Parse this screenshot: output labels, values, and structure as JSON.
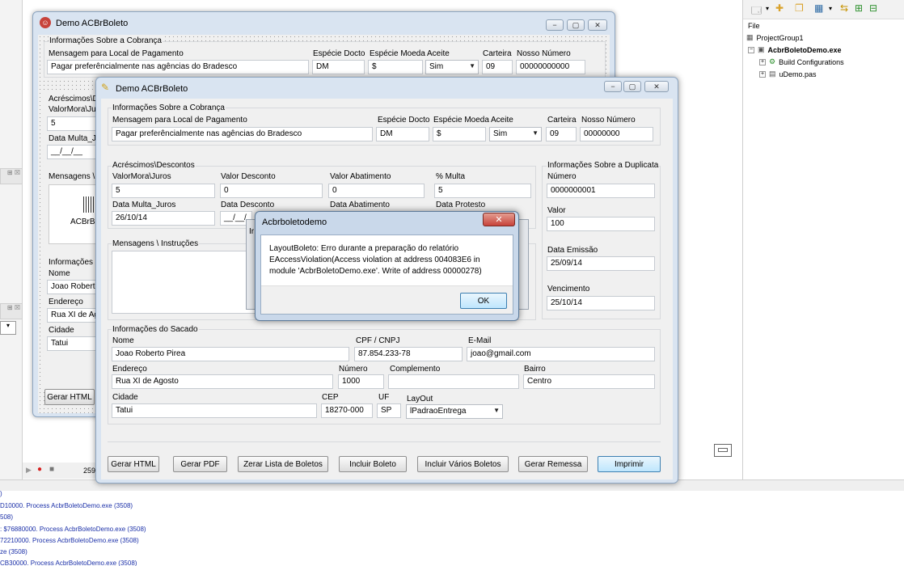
{
  "ide": {
    "status_number": "259",
    "log_lines": [
      ")",
      "D10000. Process AcbrBoletoDemo.exe (3508)",
      "508)",
      ": $76880000. Process AcbrBoletoDemo.exe (3508)",
      "72210000. Process AcbrBoletoDemo.exe (3508)",
      "ze (3508)",
      "CB30000. Process AcbrBoletoDemo.exe (3508)"
    ],
    "panel_label": "File",
    "tree": {
      "group": "ProjectGroup1",
      "project": "AcbrBoletoDemo.exe",
      "build": "Build Configurations",
      "unit": "uDemo.pas"
    }
  },
  "back_window": {
    "title": "Demo ACBrBoleto",
    "cobranca_group": "Informações Sobre a Cobrança",
    "mensagem_label": "Mensagem para Local de Pagamento",
    "mensagem_value": "Pagar preferêncialmente nas agências do Bradesco",
    "especie_docto_label": "Espécie Docto",
    "especie_docto_value": "DM",
    "especie_moeda_label": "Espécie Moeda",
    "especie_moeda_value": "$",
    "aceite_label": "Aceite",
    "aceite_value": "Sim",
    "carteira_label": "Carteira",
    "carteira_value": "09",
    "nosso_numero_label": "Nosso Número",
    "nosso_numero_value": "00000000000",
    "acrescimos_label": "Acréscimos\\D",
    "valor_mora_label": "ValorMora\\Jur",
    "valor_mora_value": "5",
    "data_multa_label": "Data Multa_Ju",
    "data_multa_value": "__/__/__",
    "mensagens_label": "Mensagens \\",
    "logo_text": "ACBrBo",
    "informacoes_label": "Informações d",
    "nome_label": "Nome",
    "nome_value": "Joao Roberto",
    "endereco_label": "Endereço",
    "endereco_value": "Rua XI de Ago",
    "cidade_label": "Cidade",
    "cidade_value": "Tatui",
    "gerar_html": "Gerar HTML"
  },
  "front_window": {
    "title": "Demo ACBrBoleto",
    "cobranca_group": "Informações Sobre a Cobrança",
    "mensagem_label": "Mensagem para Local de Pagamento",
    "mensagem_value": "Pagar preferêncialmente nas agências do Bradesco",
    "especie_docto_label": "Espécie Docto",
    "especie_docto_value": "DM",
    "especie_moeda_label": "Espécie Moeda",
    "especie_moeda_value": "$",
    "aceite_label": "Aceite",
    "aceite_value": "Sim",
    "carteira_label": "Carteira",
    "carteira_value": "09",
    "nosso_numero_label": "Nosso Número",
    "nosso_numero_value": "00000000",
    "acrescimos_group": "Acréscimos\\Descontos",
    "valor_mora_label": "ValorMora\\Juros",
    "valor_mora_value": "5",
    "valor_desconto_label": "Valor Desconto",
    "valor_desconto_value": "0",
    "valor_abatimento_label": "Valor Abatimento",
    "valor_abatimento_value": "0",
    "multa_label": "% Multa",
    "multa_value": "5",
    "data_multa_label": "Data Multa_Juros",
    "data_multa_value": "26/10/14",
    "data_desconto_label": "Data Desconto",
    "data_desconto_value": "__/__/__",
    "data_abatimento_label": "Data Abatimento",
    "data_protesto_label": "Data Protesto",
    "mensagens_group": "Mensagens \\ Instruções",
    "duplicata_group": "Informações Sobre a Duplicata",
    "numero_label": "Número",
    "numero_value": "0000000001",
    "valor_label": "Valor",
    "valor_value": "100",
    "data_emissao_label": "Data Emissão",
    "data_emissao_value": "25/09/14",
    "vencimento_label": "Vencimento",
    "vencimento_value": "25/10/14",
    "sacado_group": "Informações do Sacado",
    "nome_label": "Nome",
    "nome_value": "Joao Roberto Pirea",
    "cpf_label": "CPF / CNPJ",
    "cpf_value": "87.854.233-78",
    "email_label": "E-Mail",
    "email_value": "joao@gmail.com",
    "endereco_label": "Endereço",
    "endereco_value": "Rua XI de Agosto",
    "numero_end_label": "Número",
    "numero_end_value": "1000",
    "complemento_label": "Complemento",
    "complemento_value": "",
    "bairro_label": "Bairro",
    "bairro_value": "Centro",
    "cidade_label": "Cidade",
    "cidade_value": "Tatui",
    "cep_label": "CEP",
    "cep_value": "18270-000",
    "uf_label": "UF",
    "uf_value": "SP",
    "layout_label": "LayOut",
    "layout_value": "lPadraoEntrega",
    "buttons": {
      "gerar_html": "Gerar HTML",
      "gerar_pdf": "Gerar PDF",
      "zerar": "Zerar Lista de Boletos",
      "incluir": "Incluir Boleto",
      "incluir_varios": "Incluir Vários Boletos",
      "gerar_remessa": "Gerar Remessa",
      "imprimir": "Imprimir"
    }
  },
  "dialog": {
    "title": "Acbrboletodemo",
    "line1": "LayoutBoleto: Erro durante a preparação do relatório",
    "line2": "EAccessViolation(Access violation at address 004083E6 in",
    "line3": "module 'AcbrBoletoDemo.exe'. Write of address 00000278)",
    "ok": "OK",
    "behind_fragment": "Ir"
  },
  "colors": {
    "dialog_close": "#c7423a",
    "link_blue": "#1a2fa8",
    "window_frame": "#d9e4f1"
  }
}
